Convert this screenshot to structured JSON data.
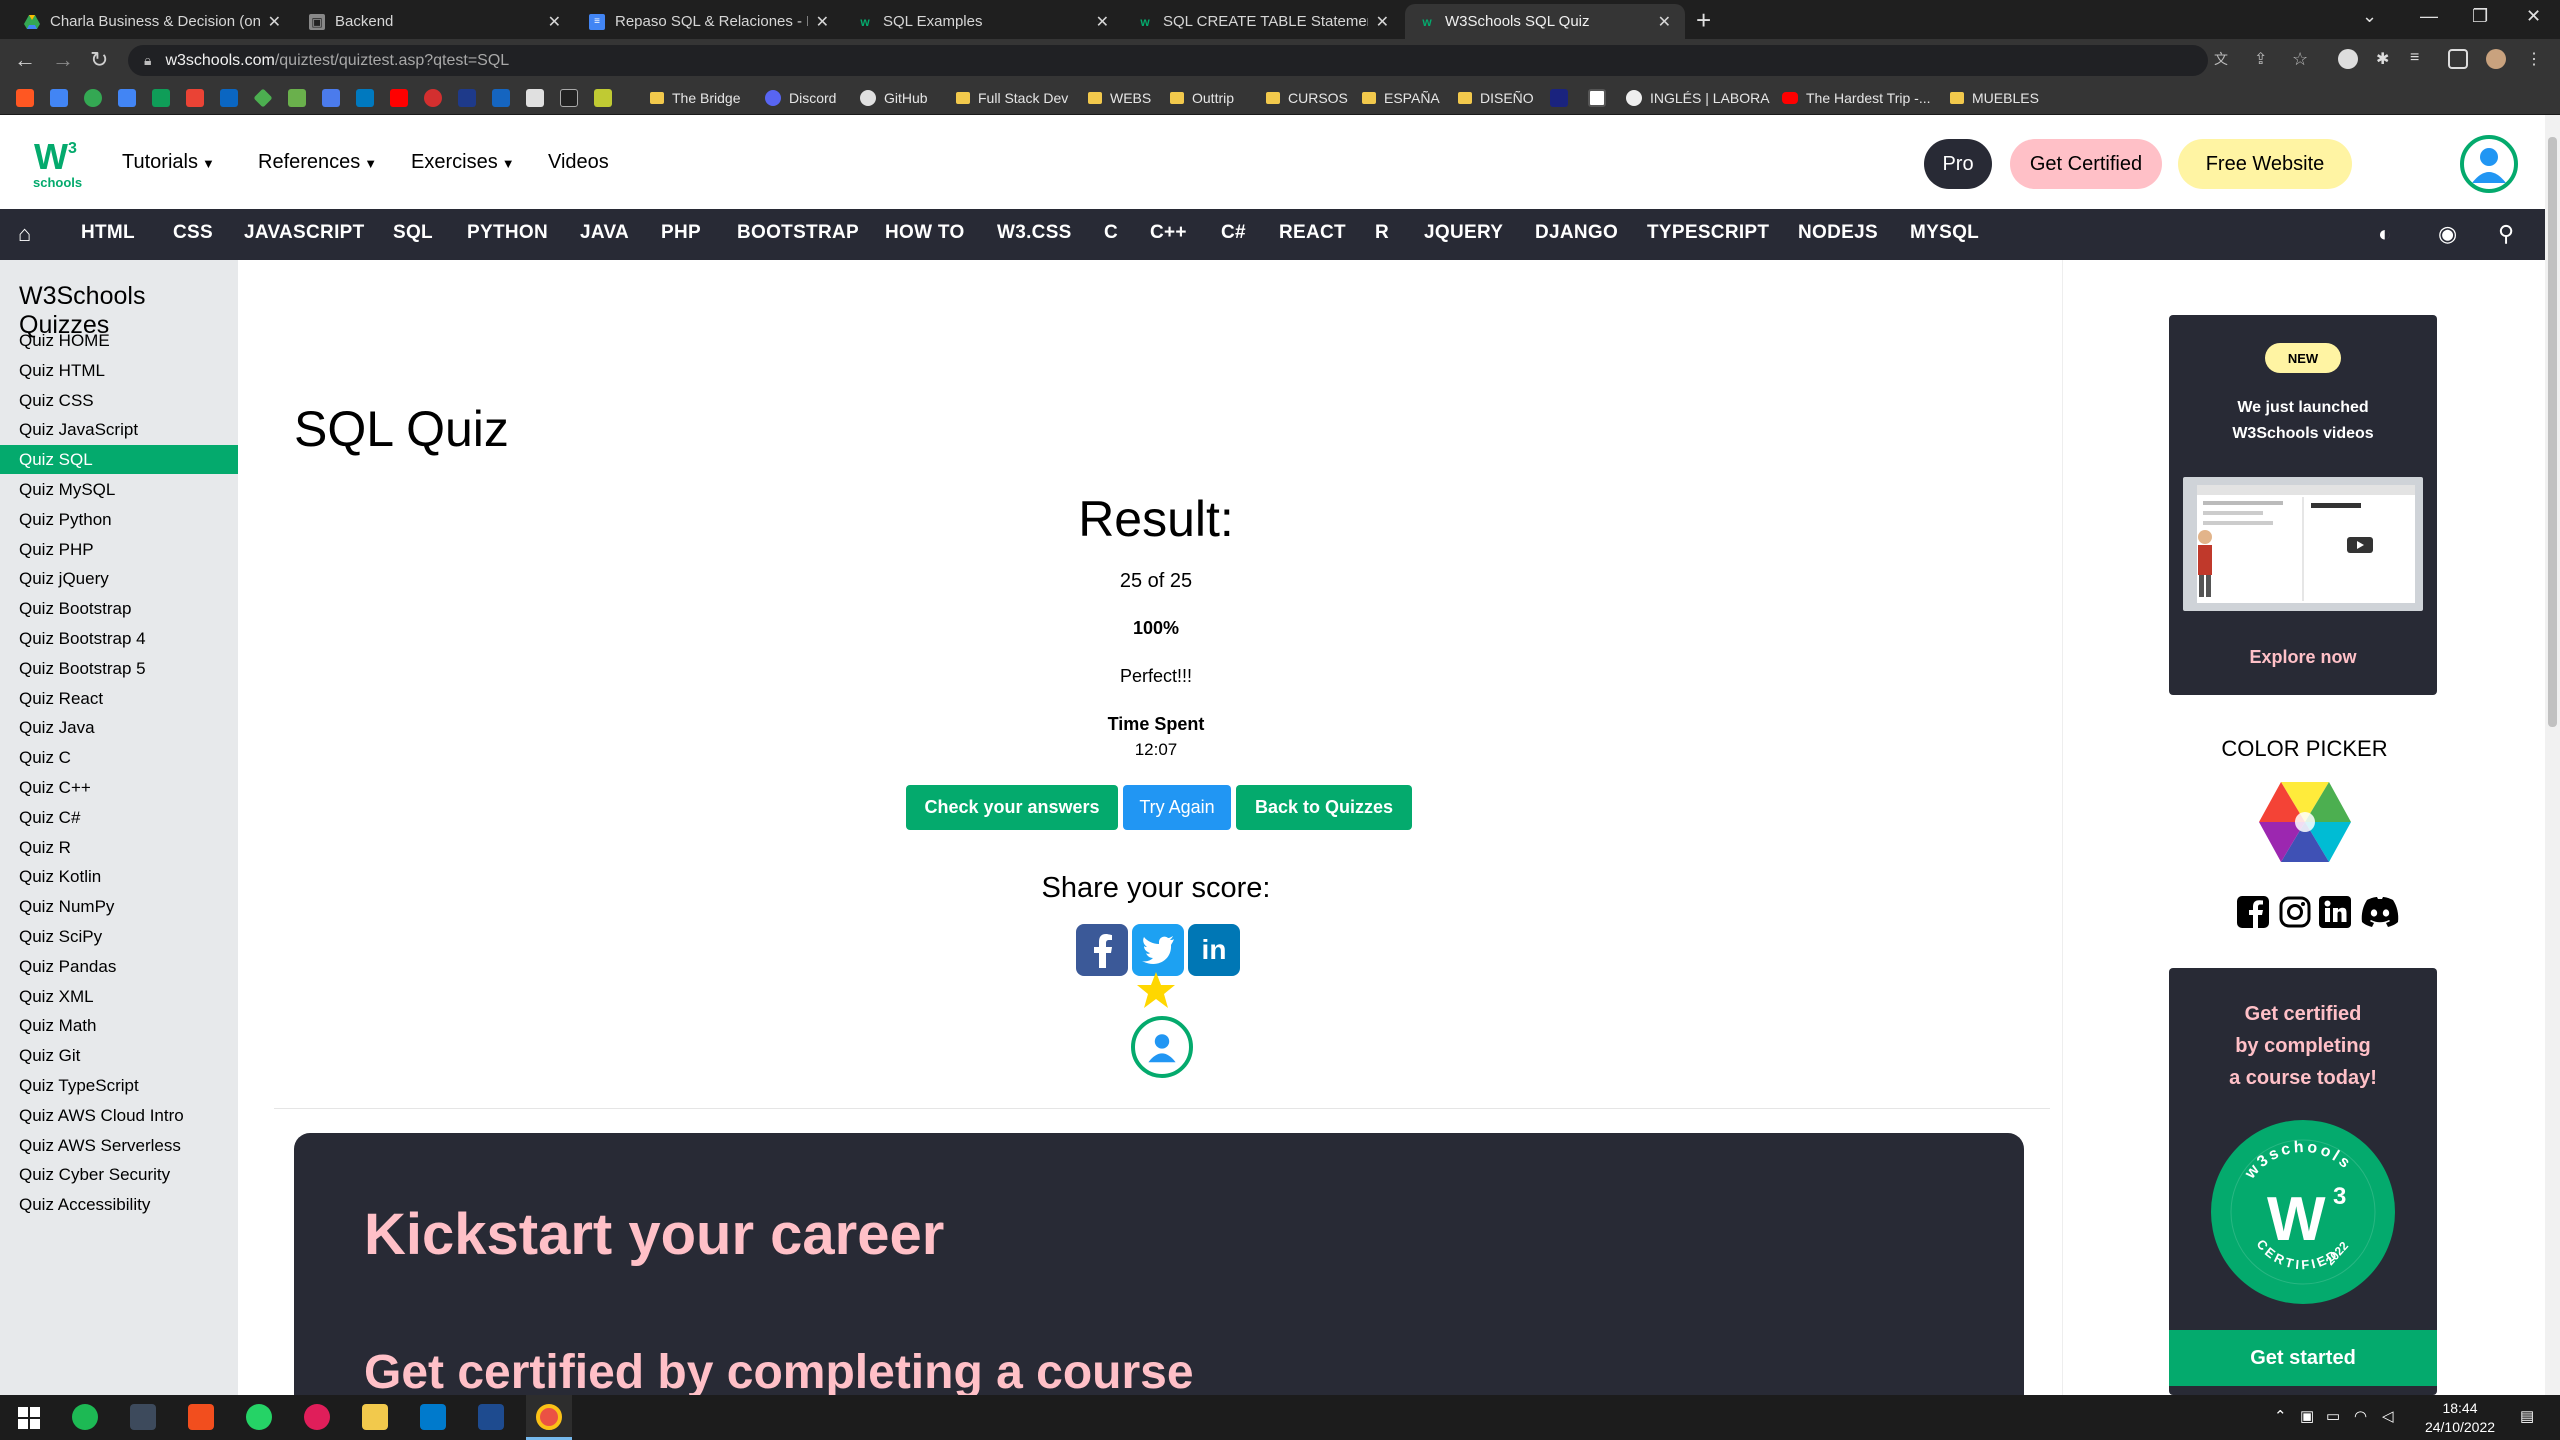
{
  "browser": {
    "tabs": [
      {
        "title": "Charla Business & Decision (onli",
        "active": false
      },
      {
        "title": "Backend",
        "active": false
      },
      {
        "title": "Repaso SQL & Relaciones - Docu",
        "active": false
      },
      {
        "title": "SQL Examples",
        "active": false
      },
      {
        "title": "SQL CREATE TABLE Statement",
        "active": false
      },
      {
        "title": "W3Schools SQL Quiz",
        "active": true
      }
    ],
    "url_host": "w3schools.com",
    "url_path": "/quiztest/quiztest.asp?qtest=SQL",
    "bookmarks": [
      "The Bridge",
      "Discord",
      "GitHub",
      "Full Stack Dev",
      "WEBS",
      "Outtrip",
      "CURSOS",
      "ESPAÑA",
      "DISEÑO",
      "INGLÉS | LABORA",
      "The Hardest Trip -...",
      "MUEBLES"
    ]
  },
  "header": {
    "logo_text": "schools",
    "logo_sup": "3",
    "menus": [
      "Tutorials",
      "References",
      "Exercises",
      "Videos"
    ],
    "pro_label": "Pro",
    "get_certified_label": "Get Certified",
    "free_website_label": "Free Website"
  },
  "subnav": [
    "HTML",
    "CSS",
    "JAVASCRIPT",
    "SQL",
    "PYTHON",
    "JAVA",
    "PHP",
    "BOOTSTRAP",
    "HOW TO",
    "W3.CSS",
    "C",
    "C++",
    "C#",
    "REACT",
    "R",
    "JQUERY",
    "DJANGO",
    "TYPESCRIPT",
    "NODEJS",
    "MYSQL"
  ],
  "sidebar": {
    "title": "W3Schools Quizzes",
    "items": [
      "Quiz HOME",
      "Quiz HTML",
      "Quiz CSS",
      "Quiz JavaScript",
      "Quiz SQL",
      "Quiz MySQL",
      "Quiz Python",
      "Quiz PHP",
      "Quiz jQuery",
      "Quiz Bootstrap",
      "Quiz Bootstrap 4",
      "Quiz Bootstrap 5",
      "Quiz React",
      "Quiz Java",
      "Quiz C",
      "Quiz C++",
      "Quiz C#",
      "Quiz R",
      "Quiz Kotlin",
      "Quiz NumPy",
      "Quiz SciPy",
      "Quiz Pandas",
      "Quiz XML",
      "Quiz Math",
      "Quiz Git",
      "Quiz TypeScript",
      "Quiz AWS Cloud Intro",
      "Quiz AWS Serverless",
      "Quiz Cyber Security",
      "Quiz Accessibility"
    ],
    "active": "Quiz SQL"
  },
  "main": {
    "title": "SQL Quiz",
    "result_heading": "Result:",
    "score": "25 of 25",
    "percent": "100%",
    "verdict": "Perfect!!!",
    "time_label": "Time Spent",
    "time_value": "12:07",
    "check_answers_label": "Check your answers",
    "try_again_label": "Try Again",
    "back_label": "Back to Quizzes",
    "share_heading": "Share your score:",
    "career_heading": "Kickstart your career",
    "career_subheading": "Get certified by completing a course"
  },
  "right": {
    "new_badge": "NEW",
    "video_line1": "We just launched",
    "video_line2": "W3Schools videos",
    "explore_label": "Explore now",
    "color_picker_label": "COLOR PICKER",
    "cert_line1": "Get certified",
    "cert_line2": "by completing",
    "cert_line3": "a course today!",
    "badge_top": "w3schools",
    "badge_bottom": "CERTIFIED",
    "badge_year": "2022",
    "get_started_label": "Get started"
  },
  "taskbar": {
    "time": "18:44",
    "date": "24/10/2022"
  },
  "colors": {
    "w3_green": "#04aa6d",
    "dark_nav": "#282a35",
    "pink": "#ffc0c7",
    "yellow": "#fff4a3",
    "try_again_blue": "#2196f3"
  }
}
